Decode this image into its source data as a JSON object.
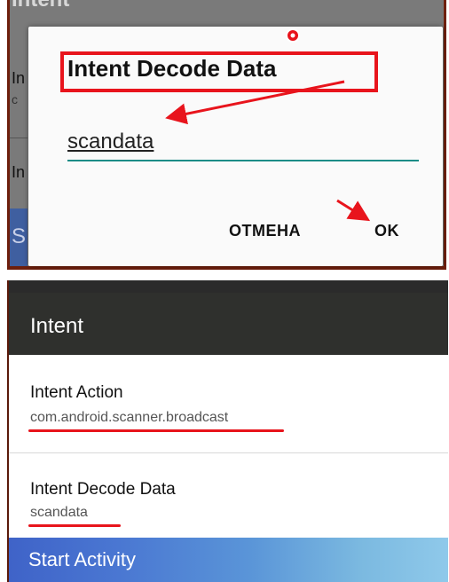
{
  "dialog": {
    "title": "Intent Decode Data",
    "input_value": "scandata",
    "cancel_label": "ОТМЕНА",
    "ok_label": "OK"
  },
  "background_screen": {
    "title": "Intent",
    "item_fragments": [
      "In",
      "c",
      "In",
      "S"
    ]
  },
  "screen": {
    "app_title": "Intent",
    "items": [
      {
        "label": "Intent Action",
        "value": "com.android.scanner.broadcast"
      },
      {
        "label": "Intent Decode Data",
        "value": "scandata"
      }
    ],
    "start_button_label": "Start Activity"
  },
  "colors": {
    "annotation_red": "#e8141c",
    "input_underline": "#1c8c87",
    "appbar": "#2f302d",
    "button_start": "#3f63c8",
    "button_end": "#8fc9ea"
  }
}
